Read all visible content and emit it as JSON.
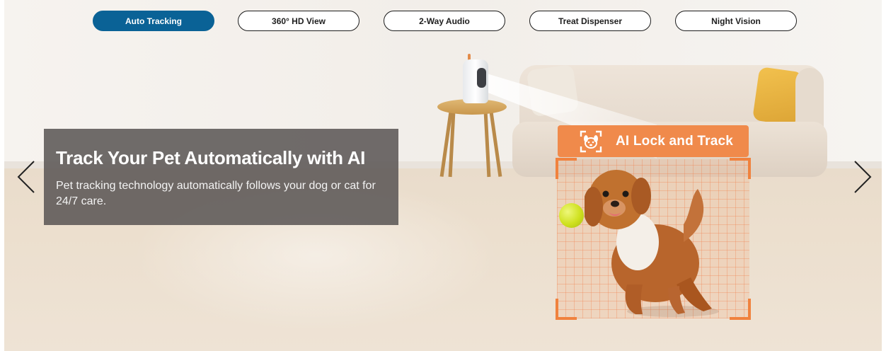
{
  "tabs": [
    {
      "label": "Auto Tracking",
      "active": true
    },
    {
      "label": "360° HD View",
      "active": false
    },
    {
      "label": "2-Way Audio",
      "active": false
    },
    {
      "label": "Treat Dispenser",
      "active": false
    },
    {
      "label": "Night Vision",
      "active": false
    }
  ],
  "slide": {
    "title": "Track Your Pet Automatically with AI",
    "description": "Pet tracking technology automatically follows your dog or cat for 24/7 care."
  },
  "badge": {
    "label": "AI Lock and Track",
    "icon": "pet-lock-icon"
  },
  "navigation": {
    "prev_icon": "chevron-left-icon",
    "next_icon": "chevron-right-icon"
  },
  "colors": {
    "active_tab": "#0a6296",
    "accent_orange": "#f08a4b",
    "caption_panel": "#5c5856"
  }
}
